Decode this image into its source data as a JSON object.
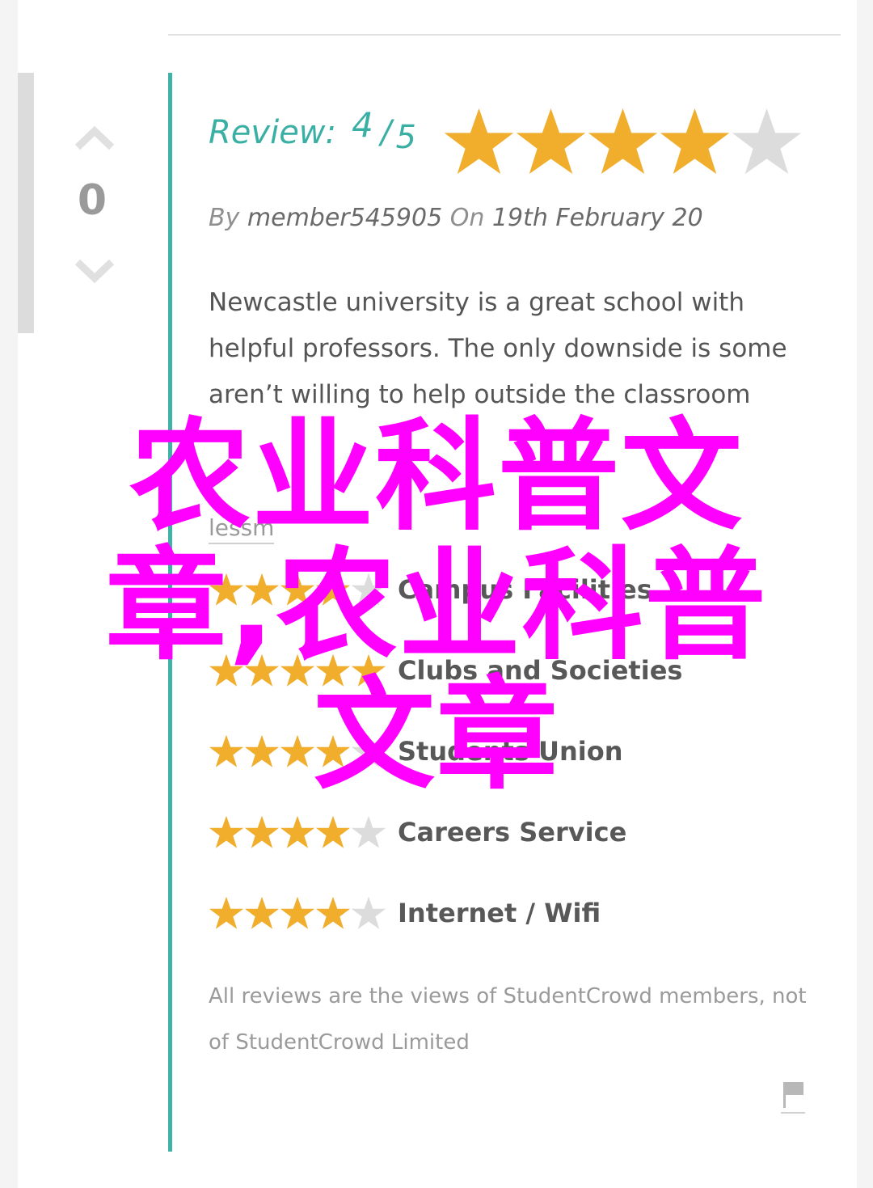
{
  "vote": {
    "count": "0"
  },
  "review": {
    "label": "Review:",
    "score": "4",
    "out_of": "5",
    "rating": 4,
    "rating_max": 5
  },
  "byline": {
    "by_text": "By",
    "author": "member545905",
    "on_text": "On",
    "date": "19th February 20"
  },
  "body": {
    "text": "Newcastle university is a great school with helpful professors. The only downside is some aren’t willing to help outside the classroom",
    "more_link": "lessm"
  },
  "categories": [
    {
      "label": "Campus Facilities",
      "rating": 4
    },
    {
      "label": "Clubs and Societies",
      "rating": 5
    },
    {
      "label": "Students Union",
      "rating": 4
    },
    {
      "label": "Careers Service",
      "rating": 4
    },
    {
      "label": "Internet / Wifi",
      "rating": 4
    }
  ],
  "disclaimer": "All reviews are the views of StudentCrowd members, not of StudentCrowd Limited",
  "overlay": {
    "text": "农业科普文章,农业科普文章"
  },
  "colors": {
    "accent_teal": "#40b3a8",
    "star_filled": "#f0ae2c",
    "star_empty": "#dcdcdc",
    "overlay": "#ff00ff"
  },
  "icons": {
    "vote_up": "chevron-up-icon",
    "vote_down": "chevron-down-icon",
    "star": "star-icon",
    "flag": "flag-icon"
  }
}
